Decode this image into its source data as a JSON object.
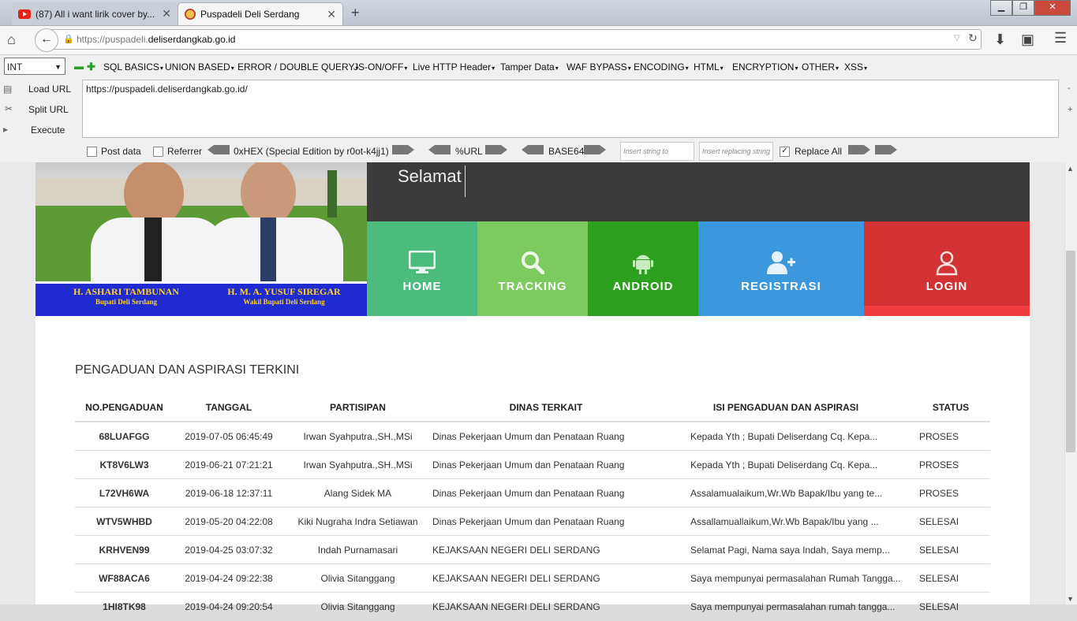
{
  "browser": {
    "tabs": [
      {
        "title": "(87) All i want lirik cover by..."
      },
      {
        "title": "Puspadeli Deli Serdang"
      }
    ],
    "url_prefix": "https://puspadeli.",
    "url_domain": "deliserdangkab.go.id"
  },
  "hackbar": {
    "select_value": "INT",
    "menus": [
      "SQL BASICS",
      "UNION BASED",
      "ERROR / DOUBLE QUERY",
      "JS-ON/OFF",
      "Live HTTP Header",
      "Tamper Data",
      "WAF BYPASS",
      "ENCODING",
      "HTML",
      "ENCRYPTION",
      "OTHER",
      "XSS"
    ],
    "load_url": "Load URL",
    "split_url": "Split URL",
    "execute": "Execute",
    "textarea": "https://puspadeli.deliserdangkab.go.id/",
    "post_data": "Post data",
    "referrer": "Referrer",
    "hex": "0xHEX (Special Edition by r0ot-k4jj1)",
    "url_enc": "%URL",
    "base64": "BASE64",
    "replace_placeholder": "Insert string to replace",
    "replacing_placeholder": "Insert replacing string",
    "replace_all": "Replace All"
  },
  "banner": {
    "person1_name": "H. ASHARI TAMBUNAN",
    "person1_title": "Bupati Deli Serdang",
    "person2_name": "H. M. A. YUSUF SIREGAR",
    "person2_title": "Wakil Bupati Deli Serdang",
    "welcome": "Selamat"
  },
  "nav_tiles": [
    {
      "label": "HOME",
      "icon": "monitor-icon",
      "color": "#4cbb7e"
    },
    {
      "label": "TRACKING",
      "icon": "search-icon",
      "color": "#7ccb5e"
    },
    {
      "label": "ANDROID",
      "icon": "android-icon",
      "color": "#2da01f"
    },
    {
      "label": "REGISTRASI",
      "icon": "add-user-icon",
      "color": "#3c98dc"
    },
    {
      "label": "LOGIN",
      "icon": "user-icon",
      "color": "#d33232"
    }
  ],
  "section_title": "PENGADUAN DAN ASPIRASI TERKINI",
  "table": {
    "headers": [
      "NO.PENGADUAN",
      "TANGGAL",
      "PARTISIPAN",
      "DINAS TERKAIT",
      "ISI PENGADUAN DAN ASPIRASI",
      "STATUS"
    ],
    "rows": [
      [
        "68LUAFGG",
        "2019-07-05 06:45:49",
        "Irwan Syahputra.,SH.,MSi",
        "Dinas Pekerjaan Umum dan Penataan Ruang",
        "Kepada Yth ; Bupati Deliserdang Cq. Kepa...",
        "PROSES"
      ],
      [
        "KT8V6LW3",
        "2019-06-21 07:21:21",
        "Irwan Syahputra.,SH.,MSi",
        "Dinas Pekerjaan Umum dan Penataan Ruang",
        "Kepada Yth ; Bupati Deliserdang Cq. Kepa...",
        "PROSES"
      ],
      [
        "L72VH6WA",
        "2019-06-18 12:37:11",
        "Alang Sidek MA",
        "Dinas Pekerjaan Umum dan Penataan Ruang",
        "Assalamualaikum,Wr.Wb Bapak/Ibu yang te...",
        "PROSES"
      ],
      [
        "WTV5WHBD",
        "2019-05-20 04:22:08",
        "Kiki Nugraha Indra Setiawan",
        "Dinas Pekerjaan Umum dan Penataan Ruang",
        "Assallamuallaikum,Wr.Wb Bapak/Ibu yang ...",
        "SELESAI"
      ],
      [
        "KRHVEN99",
        "2019-04-25 03:07:32",
        "Indah Purnamasari",
        "KEJAKSAAN NEGERI DELI SERDANG",
        "Selamat Pagi, Nama saya Indah, Saya memp...",
        "SELESAI"
      ],
      [
        "WF88ACA6",
        "2019-04-24 09:22:38",
        "Olivia Sitanggang",
        "KEJAKSAAN NEGERI DELI SERDANG",
        "Saya mempunyai permasalahan Rumah Tangga...",
        "SELESAI"
      ],
      [
        "1HI8TK98",
        "2019-04-24 09:20:54",
        "Olivia Sitanggang",
        "KEJAKSAAN NEGERI DELI SERDANG",
        "Saya mempunyai permasalahan rumah tangga...",
        "SELESAI"
      ]
    ]
  }
}
